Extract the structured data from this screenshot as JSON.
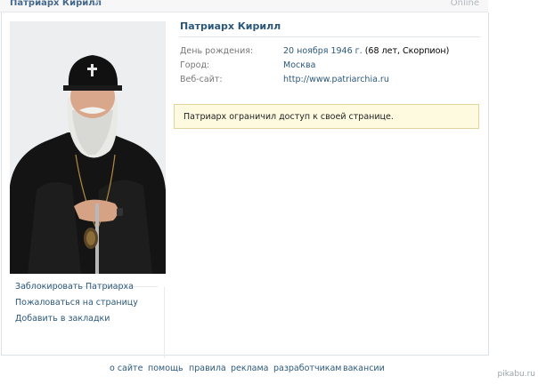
{
  "header": {
    "name": "Патриарх Кирилл",
    "status": "Online"
  },
  "profile": {
    "name": "Патриарх Кирилл",
    "info": [
      {
        "label": "День рождения:",
        "value_link": "20 ноября 1946 г.",
        "value_rest": " (68 лет, Скорпион)"
      },
      {
        "label": "Город:",
        "value_link": "Москва",
        "value_rest": ""
      },
      {
        "label": "Веб-сайт:",
        "value_link": "http://www.patriarchia.ru",
        "value_rest": ""
      }
    ],
    "notice": "Патриарх ограничил доступ к своей странице."
  },
  "actions": [
    "Заблокировать Патриарха",
    "Пожаловаться на страницу",
    "Добавить в закладки"
  ],
  "footer": [
    "о сайте",
    "помощь",
    "правила",
    "реклама",
    "разработчикам",
    "вакансии"
  ],
  "watermark": "pikabu.ru",
  "icons": {
    "verified": "check-icon",
    "photo": "profile-photo"
  },
  "colors": {
    "link": "#2b587a",
    "accent": "#45688e",
    "notice_bg": "#fefae0"
  }
}
